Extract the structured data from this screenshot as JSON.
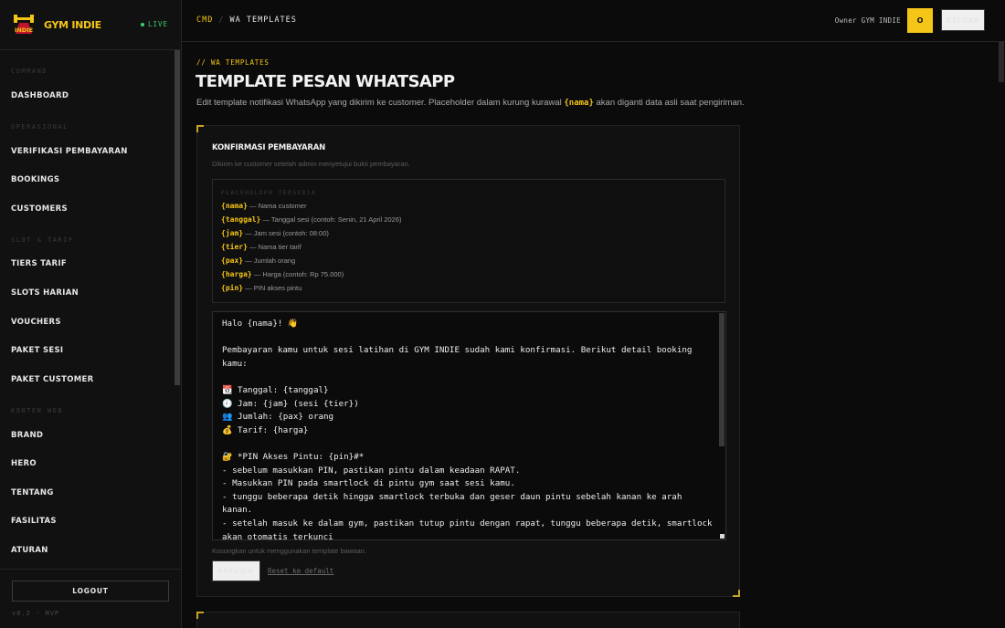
{
  "brand": {
    "name": "GYM INDIE",
    "logo_text": "INDIE",
    "status": "LIVE"
  },
  "sidebar": {
    "sections": [
      {
        "label": "COMMAND"
      },
      {
        "label": "OPERASIONAL"
      },
      {
        "label": "SLOT & TARIF"
      },
      {
        "label": "KONTEN WEB"
      }
    ],
    "items": [
      {
        "label": "DASHBOARD"
      },
      {
        "label": "VERIFIKASI PEMBAYARAN"
      },
      {
        "label": "BOOKINGS"
      },
      {
        "label": "CUSTOMERS"
      },
      {
        "label": "TIERS TARIF"
      },
      {
        "label": "SLOTS HARIAN"
      },
      {
        "label": "VOUCHERS"
      },
      {
        "label": "PAKET SESI"
      },
      {
        "label": "PAKET CUSTOMER"
      },
      {
        "label": "BRAND"
      },
      {
        "label": "HERO"
      },
      {
        "label": "TENTANG"
      },
      {
        "label": "FASILITAS"
      },
      {
        "label": "ATURAN"
      }
    ],
    "logout_label": "LOGOUT",
    "version": "v0.2 · MVP"
  },
  "topbar": {
    "breadcrumb_root": "CMD",
    "breadcrumb_sep": "/",
    "breadcrumb_current": "WA TEMPLATES",
    "owner_label": "Owner GYM INDIE",
    "avatar_initial": "O",
    "keluar_label": "KELUAR"
  },
  "page": {
    "eyebrow": "// WA TEMPLATES",
    "title": "TEMPLATE PESAN WHATSAPP",
    "desc_before": "Edit template notifikasi WhatsApp yang dikirim ke customer. Placeholder dalam kurung kurawal",
    "desc_placeholder": "{nama}",
    "desc_after": "akan diganti data asli saat pengiriman."
  },
  "template_card": {
    "title": "KONFIRMASI PEMBAYARAN",
    "desc": "Dikirim ke customer setelah admin menyetujui bukti pembayaran.",
    "placeholders_heading": "PLACEHOLDER TERSEDIA",
    "placeholders": [
      {
        "key": "{nama}",
        "desc": "— Nama customer"
      },
      {
        "key": "{tanggal}",
        "desc": "— Tanggal sesi (contoh: Senin, 21 April 2026)"
      },
      {
        "key": "{jam}",
        "desc": "— Jam sesi (contoh: 08:00)"
      },
      {
        "key": "{tier}",
        "desc": "— Nama tier tarif"
      },
      {
        "key": "{pax}",
        "desc": "— Jumlah orang"
      },
      {
        "key": "{harga}",
        "desc": "— Harga (contoh: Rp 75.000)"
      },
      {
        "key": "{pin}",
        "desc": "— PIN akses pintu"
      }
    ],
    "template_value": "Halo {nama}! 👋\n\nPembayaran kamu untuk sesi latihan di GYM INDIE sudah kami konfirmasi. Berikut detail booking kamu:\n\n📆 Tanggal: {tanggal}\n🕗 Jam: {jam} (sesi {tier})\n👥 Jumlah: {pax} orang\n💰 Tarif: {harga}\n\n🔐 *PIN Akses Pintu: {pin}#*\n- sebelum masukkan PIN, pastikan pintu dalam keadaan RAPAT.\n- Masukkan PIN pada smartlock di pintu gym saat sesi kamu.\n- tunggu beberapa detik hingga smartlock terbuka dan geser daun pintu sebelah kanan ke arah kanan.\n- setelah masuk ke dalam gym, pastikan tutup pintu dengan rapat, tunggu beberapa detik, smartlock akan otomatis terkunci",
    "hint": "Kosongkan untuk menggunakan template bawaan.",
    "preview_label": "PREVIEW",
    "reset_label": "Reset ke default"
  },
  "colors": {
    "accent": "#f5c518",
    "live": "#3ecf6e",
    "background": "#0b0b0b",
    "panel": "#111111"
  }
}
